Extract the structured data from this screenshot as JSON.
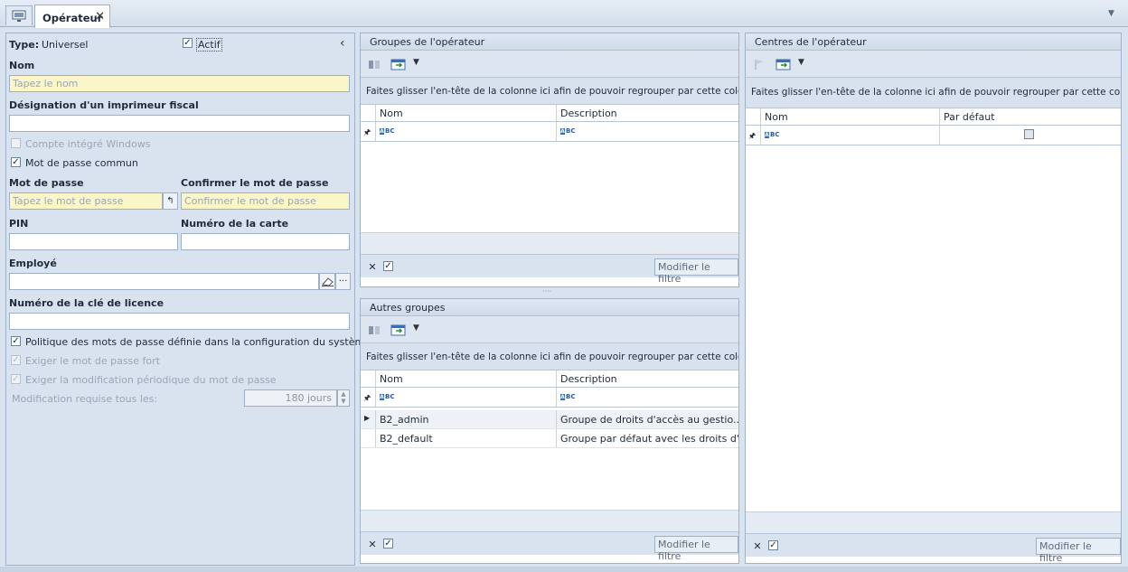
{
  "tabs": {
    "home_tab_icon": "monitor-icon",
    "active_tab_label": "Opérateur",
    "close_symbol": "✕",
    "overflow_symbol": "▼"
  },
  "form": {
    "type_label": "Type:",
    "type_value": "Universel",
    "active_label": "Actif",
    "active_checked": true,
    "collapse_symbol": "‹",
    "name_label": "Nom",
    "name_placeholder": "Tapez le nom",
    "fiscal_label": "Désignation d'un imprimeur fiscal",
    "fiscal_value": "",
    "windows_account_label": "Compte intégré Windows",
    "common_password_label": "Mot de passe commun",
    "password_label": "Mot de passe",
    "password_placeholder": "Tapez le mot de passe",
    "confirm_label": "Confirmer le mot de passe",
    "confirm_placeholder": "Confirmer le mot de passe",
    "pin_label": "PIN",
    "card_label": "Numéro de la carte",
    "employee_label": "Employé",
    "license_label": "Numéro de la clé de licence",
    "policy_label": "Politique des mots de passe définie dans la configuration du système",
    "strong_label": "Exiger le mot de passe fort",
    "periodic_label": "Exiger la modification périodique du mot de passe",
    "modification_label": "Modification requise tous les:",
    "modification_value": "180 jours"
  },
  "groups_panel": {
    "title": "Groupes de l'opérateur",
    "group_by_hint": "Faites glisser l'en-tête de la colonne ici afin de pouvoir regrouper par cette colc",
    "columns": [
      "Nom",
      "Description"
    ],
    "filter_button": "Modifier le filtre",
    "rows": []
  },
  "other_groups_panel": {
    "title": "Autres groupes",
    "group_by_hint": "Faites glisser l'en-tête de la colonne ici afin de pouvoir regrouper par cette colc",
    "columns": [
      "Nom",
      "Description"
    ],
    "filter_button": "Modifier le filtre",
    "rows": [
      {
        "name": "B2_admin",
        "description": "Groupe de droits d'accès au gestio..."
      },
      {
        "name": "B2_default",
        "description": "Groupe par défaut avec les droits d'..."
      }
    ]
  },
  "centers_panel": {
    "title": "Centres de l'opérateur",
    "group_by_hint": "Faites glisser l'en-tête de la colonne ici afin de pouvoir regrouper par cette col",
    "columns": [
      "Nom",
      "Par défaut"
    ],
    "filter_button": "Modifier le filtre"
  },
  "icons": {
    "abc": "BC",
    "pin": "📍"
  }
}
